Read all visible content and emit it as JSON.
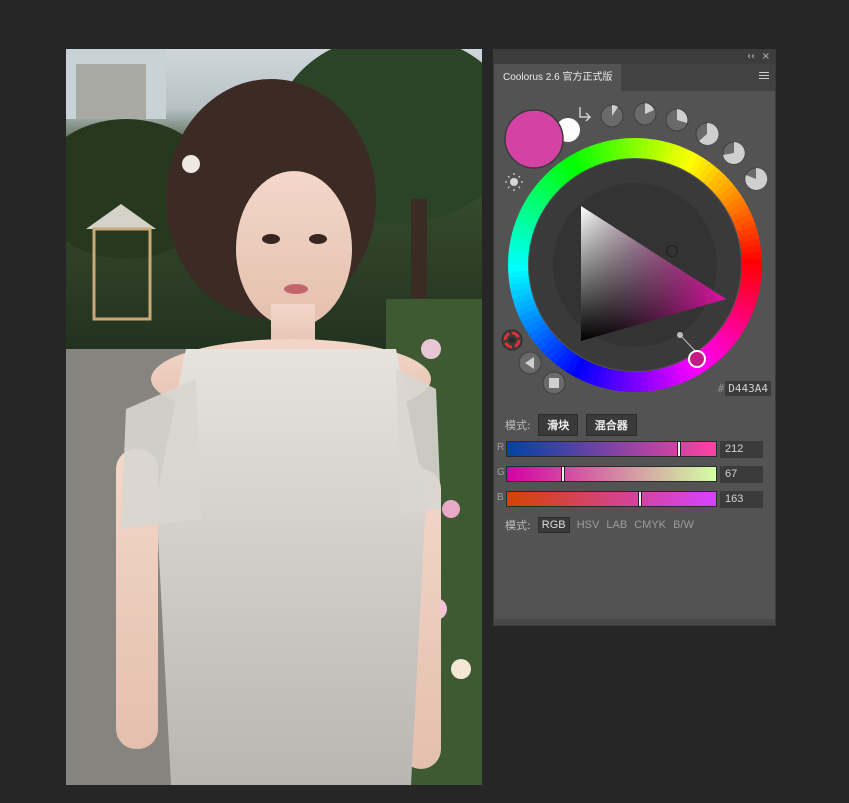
{
  "panel": {
    "tab_title": "Coolorus 2.6 官方正式版",
    "collapse_glyph": "‹‹",
    "close_glyph": "×",
    "hex_hash": "#",
    "hex_value": "D443A4",
    "mode_label": "模式:",
    "mode_buttons": [
      "滑块",
      "混合器"
    ],
    "sliders": [
      {
        "letter": "R",
        "value": "212",
        "fraction": 0.831
      },
      {
        "letter": "G",
        "value": "67",
        "fraction": 0.263
      },
      {
        "letter": "B",
        "value": "163",
        "fraction": 0.639
      }
    ],
    "color_modes_label": "模式:",
    "color_modes": [
      "RGB",
      "HSV",
      "LAB",
      "CMYK",
      "B/W"
    ],
    "active_color_mode": "RGB"
  },
  "colors": {
    "foreground": "#D443A4",
    "background": "#FFFFFF",
    "panel_bg": "#535353"
  },
  "icons": [
    "swap-arrows-icon",
    "sun-icon",
    "preset-swatch-icon",
    "wheel-mode-icon",
    "triangle-mode-icon",
    "square-mode-icon",
    "menu-icon"
  ]
}
